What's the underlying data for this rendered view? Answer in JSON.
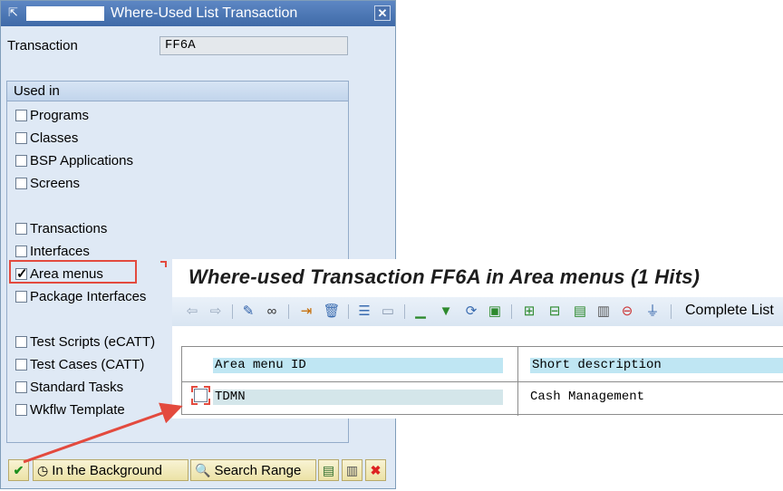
{
  "dialog": {
    "title": "Where-Used List Transaction",
    "close_glyph": "✕",
    "transaction_label": "Transaction",
    "transaction_value": "FF6A",
    "used_in_header": "Used in",
    "options": [
      {
        "label": "Programs",
        "checked": false
      },
      {
        "label": "Classes",
        "checked": false
      },
      {
        "label": "BSP Applications",
        "checked": false
      },
      {
        "label": "Screens",
        "checked": false
      },
      {
        "label": "Transactions",
        "checked": false
      },
      {
        "label": "Interfaces",
        "checked": false
      },
      {
        "label": "Area menus",
        "checked": true
      },
      {
        "label": "Package Interfaces",
        "checked": false
      },
      {
        "label": "Test Scripts (eCATT)",
        "checked": false
      },
      {
        "label": "Test Cases (CATT)",
        "checked": false
      },
      {
        "label": "Standard Tasks",
        "checked": false
      },
      {
        "label": "Wkflw Template",
        "checked": false
      }
    ],
    "buttons": {
      "background": "In the Background",
      "search_range": "Search Range"
    }
  },
  "result": {
    "title": "Where-used Transaction FF6A in Area menus (1 Hits)",
    "complete_list": "Complete List",
    "columns": [
      "Area menu ID",
      "Short description"
    ],
    "rows": [
      {
        "id": "TDMN",
        "description": "Cash Management"
      }
    ]
  },
  "colors": {
    "highlight": "#e34a3e",
    "title_bar": "#3f6aa8",
    "header_cell": "#bfe6f3"
  }
}
